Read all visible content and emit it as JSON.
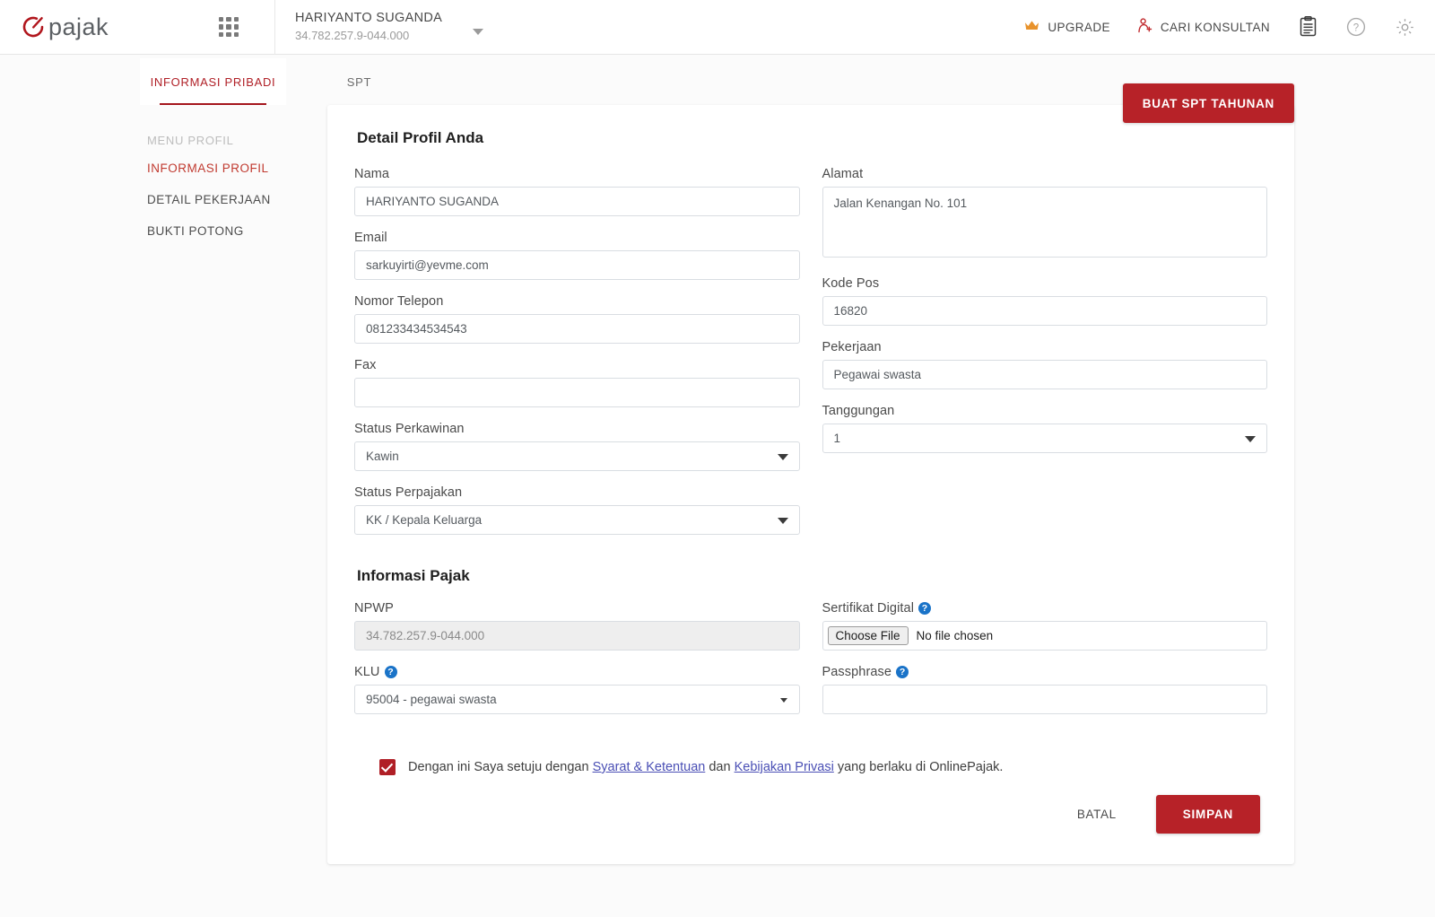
{
  "header": {
    "logo_text": "pajak",
    "logo_icon": "pajak-logo-icon",
    "apps_icon": "apps-grid-icon",
    "profile": {
      "name": "HARIYANTO SUGANDA",
      "npwp": "34.782.257.9-044.000"
    },
    "upgrade_label": "UPGRADE",
    "upgrade_icon": "crown-icon",
    "consultant_label": "CARI KONSULTAN",
    "consultant_icon": "consultant-person-icon",
    "clipboard_icon": "clipboard-icon",
    "help_icon": "question-circle-icon",
    "settings_icon": "gear-icon"
  },
  "tabs": [
    {
      "label": "INFORMASI PRIBADI",
      "active": true
    },
    {
      "label": "SPT",
      "active": false
    }
  ],
  "top_action": {
    "label": "BUAT SPT TAHUNAN"
  },
  "sidebar": {
    "heading": "MENU PROFIL",
    "items": [
      {
        "label": "INFORMASI PROFIL",
        "active": true
      },
      {
        "label": "DETAIL PEKERJAAN",
        "active": false
      },
      {
        "label": "BUKTI POTONG",
        "active": false
      }
    ]
  },
  "profile_section": {
    "title": "Detail Profil Anda",
    "left": {
      "nama_label": "Nama",
      "nama_value": "HARIYANTO SUGANDA",
      "email_label": "Email",
      "email_value": "sarkuyirti@yevme.com",
      "telepon_label": "Nomor Telepon",
      "telepon_value": "081233434534543",
      "fax_label": "Fax",
      "fax_value": "",
      "status_perkawinan_label": "Status Perkawinan",
      "status_perkawinan_value": "Kawin",
      "status_perpajakan_label": "Status Perpajakan",
      "status_perpajakan_value": "KK / Kepala Keluarga"
    },
    "right": {
      "alamat_label": "Alamat",
      "alamat_value": "Jalan Kenangan No. 101",
      "kodepos_label": "Kode Pos",
      "kodepos_value": "16820",
      "pekerjaan_label": "Pekerjaan",
      "pekerjaan_value": "Pegawai swasta",
      "tanggungan_label": "Tanggungan",
      "tanggungan_value": "1"
    }
  },
  "tax_section": {
    "title": "Informasi Pajak",
    "left": {
      "npwp_label": "NPWP",
      "npwp_value": "34.782.257.9-044.000",
      "klu_label": "KLU",
      "klu_value": "95004 - pegawai swasta"
    },
    "right": {
      "sertifikat_label": "Sertifikat Digital",
      "choose_file_label": "Choose File",
      "no_file_label": "No file chosen",
      "passphrase_label": "Passphrase",
      "passphrase_value": ""
    },
    "help_icon": "help-question-icon"
  },
  "agreement": {
    "checked": true,
    "text_before": "Dengan ini Saya setuju dengan ",
    "link1": "Syarat & Ketentuan",
    "text_middle": " dan ",
    "link2": "Kebijakan Privasi",
    "text_after": " yang berlaku di OnlinePajak."
  },
  "footer": {
    "cancel_label": "BATAL",
    "save_label": "SIMPAN"
  },
  "colors": {
    "brand_red": "#b72228",
    "accent_red": "#c0392f",
    "link_blue": "#4a4fb5",
    "help_blue": "#1a73c8",
    "upgrade_orange": "#e8922b",
    "page_bg": "#fbfbfb"
  }
}
